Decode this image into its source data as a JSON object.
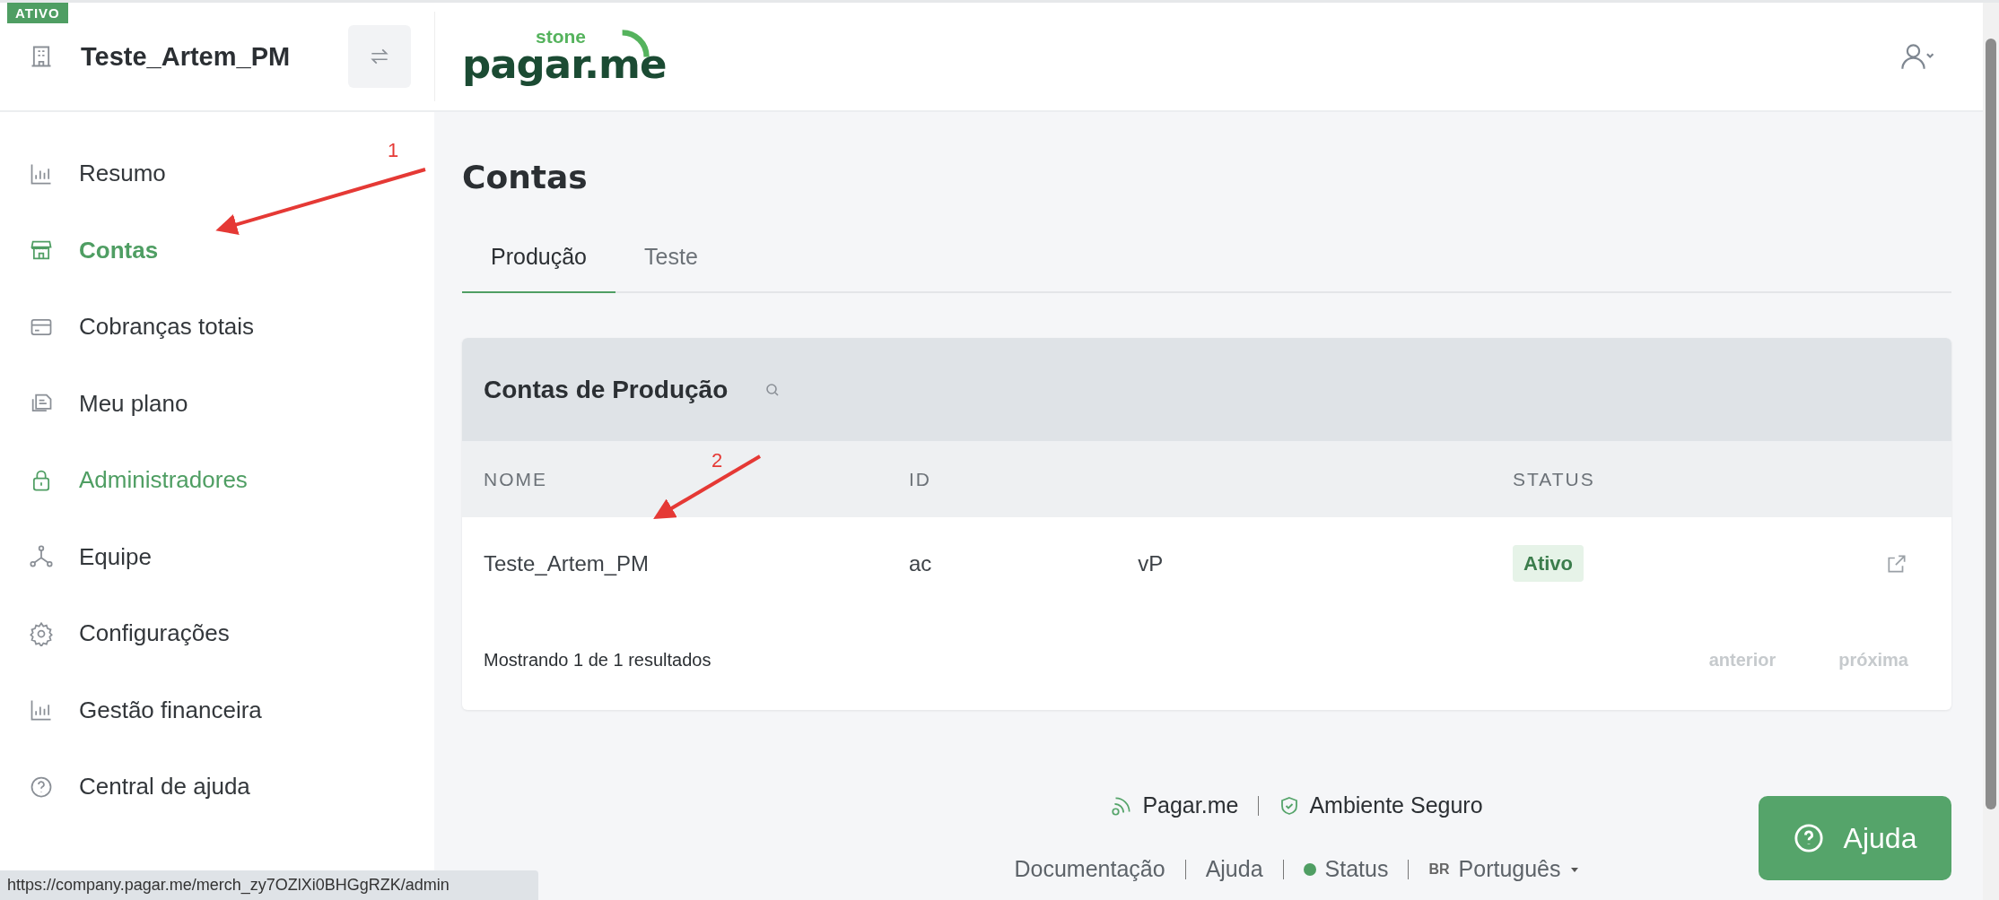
{
  "account_badge": "ATIVO",
  "account": {
    "name": "Teste_Artem_PM"
  },
  "logo": {
    "top": "stone",
    "main": "pagar.me"
  },
  "sidebar": {
    "items": [
      {
        "label": "Resumo",
        "selected": false,
        "hovered": false
      },
      {
        "label": "Contas",
        "selected": true,
        "hovered": false
      },
      {
        "label": "Cobranças totais",
        "selected": false,
        "hovered": false
      },
      {
        "label": "Meu plano",
        "selected": false,
        "hovered": false
      },
      {
        "label": "Administradores",
        "selected": false,
        "hovered": true
      },
      {
        "label": "Equipe",
        "selected": false,
        "hovered": false
      },
      {
        "label": "Configurações",
        "selected": false,
        "hovered": false
      },
      {
        "label": "Gestão financeira",
        "selected": false,
        "hovered": false
      },
      {
        "label": "Central de ajuda",
        "selected": false,
        "hovered": false
      }
    ]
  },
  "page_title": "Contas",
  "tabs": [
    {
      "label": "Produção",
      "selected": true
    },
    {
      "label": "Teste",
      "selected": false
    }
  ],
  "table": {
    "title": "Contas de Produção",
    "columns": [
      "NOME",
      "ID",
      "STATUS"
    ],
    "rows": [
      {
        "name": "Teste_Artem_PM",
        "id_start": "ac",
        "id_end": "vP",
        "status": "Ativo"
      }
    ],
    "summary": "Mostrando 1 de 1 resultados",
    "prev": "anterior",
    "next": "próxima"
  },
  "footer": {
    "brand": "Pagar.me",
    "secure": "Ambiente Seguro",
    "links": [
      "Documentação",
      "Ajuda"
    ],
    "status": "Status",
    "lang_code": "BR",
    "language": "Português"
  },
  "help_button": "Ajuda",
  "status_url": "https://company.pagar.me/merch_zy7OZlXi0BHGgRZK/admin",
  "annotations": [
    {
      "label": "1"
    },
    {
      "label": "2"
    }
  ]
}
